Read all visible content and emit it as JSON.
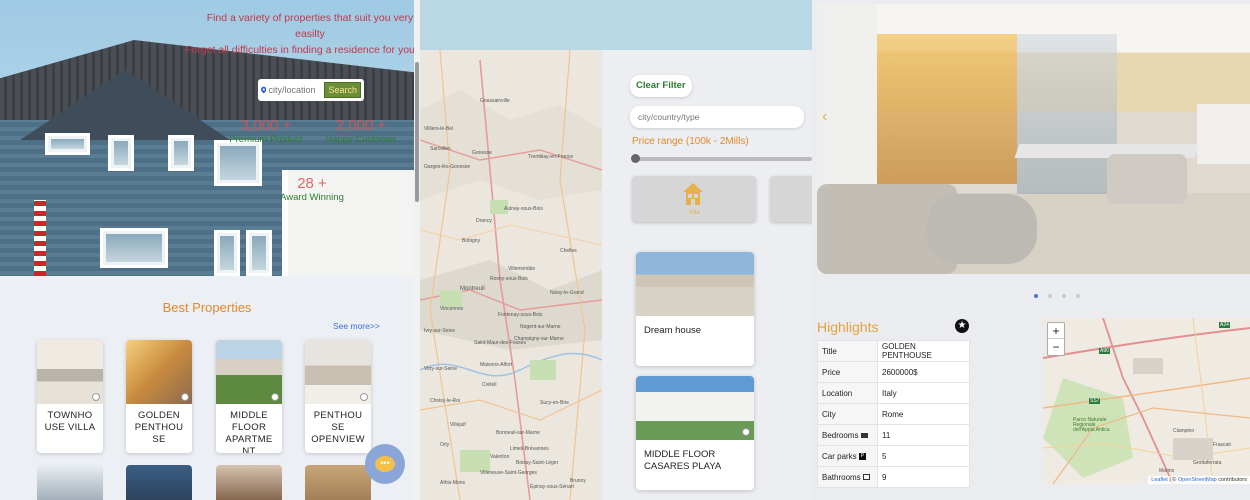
{
  "hero": {
    "tagline1": "Find a variety of properties that suit you very",
    "tagline2": "easilty",
    "tagline3": "Forget all difficulties in finding a residence for you",
    "search_placeholder": "city/location",
    "search_button": "Search",
    "stats": [
      {
        "num": "3,000 +",
        "label": "Premium Product"
      },
      {
        "num": "2,000 +",
        "label": "Happy Customer"
      },
      {
        "num": "28 +",
        "label": "Award Winning"
      }
    ]
  },
  "best_properties": {
    "title": "Best Properties",
    "see_more": "See more>>",
    "cards": [
      {
        "title": "TOWNHO USE VILLA"
      },
      {
        "title": "GOLDEN PENTHOU SE"
      },
      {
        "title": "MIDDLE FLOOR APARTME NT"
      },
      {
        "title": "PENTHOU SE OPENVIEW"
      }
    ]
  },
  "filter": {
    "clear_filter": "Clear Filter",
    "city_placeholder": "city/country/type",
    "price_range": "Price range (100k - 2Mills)",
    "type_label": "Villa",
    "listings": [
      {
        "title": "Dream house"
      },
      {
        "title": "MIDDLE FLOOR CASARES PLAYA"
      }
    ]
  },
  "map_labels": [
    "Goussainville",
    "Villiers-le-Bel",
    "Sarcelles",
    "Gonesse",
    "Garges-lès-Gonesse",
    "Tremblay-en-France",
    "Aulnay-sous-Bois",
    "Drancy",
    "Bobigny",
    "Montreuil",
    "Vincennes",
    "Saint-Maur-des-Fossés",
    "Créteil",
    "Ivry-sur-Seine",
    "Vitry-sur-Seine",
    "Choisy-le-Roi",
    "Orly",
    "Villejuif",
    "Champigny-sur-Marne",
    "Noisy-le-Grand",
    "Chelles",
    "Villemomble",
    "Rosny-sous-Bois",
    "Fontenay-sous-Bois",
    "Nogent-sur-Marne",
    "Maisons-Alfort",
    "Bonneuil-sur-Marne",
    "Sucy-en-Brie",
    "Boissy-Saint-Léger",
    "Villeneuve-Saint-Georges",
    "Limeil-Brévannes",
    "Valenton",
    "Athis-Mons",
    "Épinay-sous-Sénart",
    "Brunoy"
  ],
  "detail": {
    "highlights": "Highlights",
    "rows": [
      {
        "key": "Title",
        "value": "GOLDEN PENTHOUSE"
      },
      {
        "key": "Price",
        "value": "2600000$"
      },
      {
        "key": "Location",
        "value": "Italy"
      },
      {
        "key": "City",
        "value": "Rome"
      },
      {
        "key": "Bedrooms",
        "value": "11"
      },
      {
        "key": "Car parks",
        "value": "5"
      },
      {
        "key": "Bathrooms",
        "value": "9"
      }
    ],
    "map_labels": [
      "A24",
      "A90",
      "SS7",
      "Frascati",
      "Ciampino",
      "Grottaferrata",
      "Marino",
      "Parco Naturale Regionale dell'Appia Antica"
    ],
    "attribution_leaflet": "Leaflet",
    "attribution_osm": "OpenStreetMap",
    "attribution_rest": "contributors"
  },
  "colors": {
    "accent": "#e08a2c",
    "green": "#2e7d32",
    "red": "#c0394b",
    "link": "#3b6fd8"
  }
}
